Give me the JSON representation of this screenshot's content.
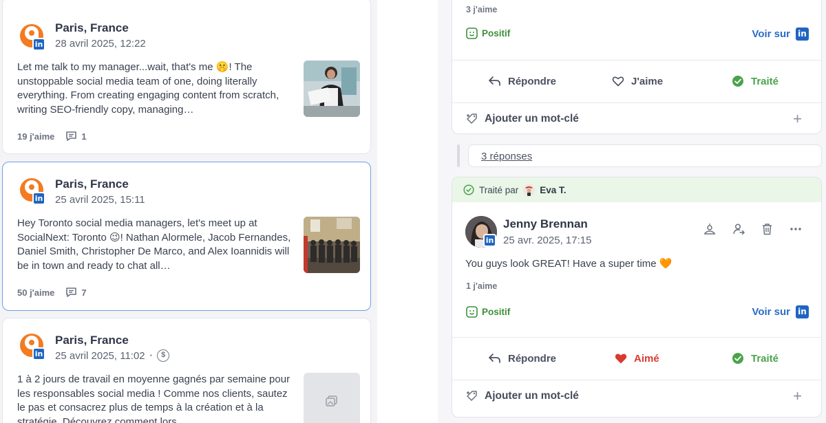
{
  "feed": {
    "posts": [
      {
        "author": "Paris, France",
        "date": "28 avril 2025, 12:22",
        "text": "Let me talk to my manager...wait, that's me 🤫! The unstoppable social media team of one, doing literally everything. From creating engaging content from scratch, writing SEO-friendly copy, managing…",
        "likes": "19 j'aime",
        "comments": "1"
      },
      {
        "author": "Paris, France",
        "date": "25 avril 2025, 15:11",
        "text": "Hey Toronto social media managers, let's meet up at SocialNext: Toronto 😉! Nathan Alormele, Jacob Fernandes, Daniel Smith, Christopher De Marco, and Alex Ioannidis will be in town and ready to chat all…",
        "likes": "50 j'aime",
        "comments": "7"
      },
      {
        "author": "Paris, France",
        "date": "25 avril 2025, 11:02",
        "dot": "•",
        "text": "1 à 2 jours de travail en moyenne gagnés par semaine pour les responsables social media ! Comme nos clients, sautez le pas et consacrez plus de temps à la création et à la stratégie. Découvrez comment lors"
      }
    ]
  },
  "detail": {
    "top_card": {
      "likes": "3 j'aime",
      "sentiment": "Positif",
      "view_on": "Voir sur",
      "reply": "Répondre",
      "like": "J'aime",
      "status": "Traité",
      "add_keyword": "Ajouter un mot-clé",
      "plus": "+"
    },
    "replies_link": "3 réponses",
    "comment_card": {
      "handled_prefix": "Traité par",
      "handled_by": "Eva T.",
      "author": "Jenny Brennan",
      "date": "25 avr. 2025, 17:15",
      "text": "You guys look GREAT! Have a super time 🧡",
      "likes": "1 j'aime",
      "sentiment": "Positif",
      "view_on": "Voir sur",
      "reply": "Répondre",
      "liked": "Aimé",
      "status": "Traité",
      "add_keyword": "Ajouter un mot-clé",
      "plus": "+"
    },
    "linkedin_glyph": "in"
  },
  "colors": {
    "accent_blue": "#2a6bc8",
    "positive_green": "#3d8f3a",
    "liked_red": "#d93a2f",
    "brand_orange": "#f47b20",
    "linkedin_blue": "#1f65c1",
    "selected_border": "#6f9ee8"
  }
}
